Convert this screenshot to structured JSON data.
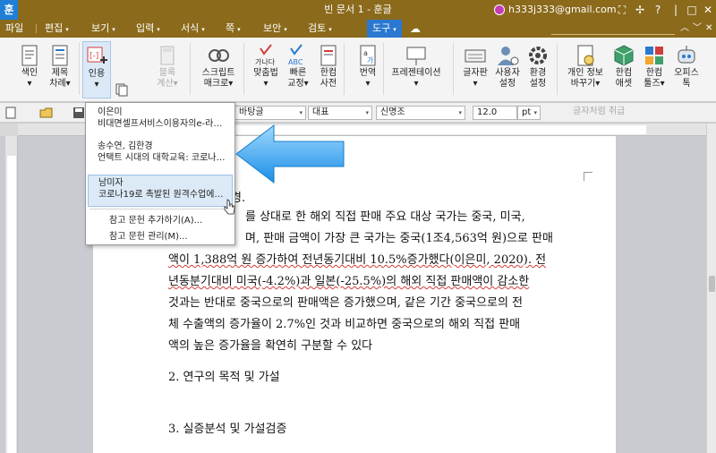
{
  "titlebar": {
    "app_icon": "훈",
    "title": "빈 문서 1 - 훈글",
    "account_email": "h333j333@gmail.com"
  },
  "window_controls": {
    "a": "⛶",
    "b": "✢",
    "help": "?",
    "minimize": "|",
    "maximize": "□",
    "close": "✕"
  },
  "menu": [
    {
      "label": "파일",
      "arrow": ""
    },
    {
      "label": "편집",
      "arrow": "▾"
    },
    {
      "label": "보기",
      "arrow": "▾"
    },
    {
      "label": "입력",
      "arrow": "▾"
    },
    {
      "label": "서식",
      "arrow": "▾"
    },
    {
      "label": "쪽",
      "arrow": "▾"
    },
    {
      "label": "보안",
      "arrow": "▾"
    },
    {
      "label": "검토",
      "arrow": "▾"
    },
    {
      "label": "도구",
      "arrow": "▾"
    }
  ],
  "menu_right": {
    "up": "︿",
    "down": "﹀",
    "close": "✕"
  },
  "ribbon": {
    "index": "색인\n▾",
    "chapter": "제목\n차례▾",
    "cite": "인용\n▾",
    "block_calc": "블록\n계산▾",
    "script": "스크립트\n매크로▾",
    "spell": "맞춤법\n▾",
    "quick": "빠른\n교정▾",
    "dict": "한컴\n사전",
    "translate": "번역\n▾",
    "present": "프레젠테이션\n▾",
    "kbd": "글자판\n▾",
    "user_set": "사용자\n설정",
    "env_set": "환경\n설정",
    "privacy": "개인 정보\n바꾸기▾",
    "asset": "한컴\n애셋",
    "tools": "한컴\n툴즈▾",
    "office_tok": "오피스\n톡",
    "spell_icon_text": "가나다",
    "spell_abc": "ABC"
  },
  "format_bar": {
    "font_lang": "바탕글",
    "font_group": "대표",
    "font_name": "신명조",
    "font_size": "12.0",
    "size_unit": "pt",
    "char_style": "글자처럼 취급"
  },
  "dropdown": {
    "items": [
      {
        "line1": "이은미",
        "line2": "비대면셀프서비스이용자의e-라…"
      },
      {
        "line1": "송수연, 김한경",
        "line2": "언택트 시대의 대학교육: 코로나…"
      },
      {
        "line1": "남미자",
        "line2": "코로나19로 촉발된 원격수업에…"
      }
    ],
    "add_ref": "참고 문헌 추가하기(A)...",
    "manage_ref": "참고 문헌 관리(M)..."
  },
  "document": {
    "line0_tail": "경.",
    "lines": [
      "를 상대로 한 해외 직접 판매 주요 대상 국가는 중국, 미국,",
      "며, 판매 금액이 가장 큰 국가는 중국(1조4,563억 원)으로 판매",
      "액이 1,388억 원 증가하여 전년동기대비 10.5%증가했다(이은미, 2020). 전",
      "년동분기대비 미국(-4.2%)과 일본(-25.5%)의 해외 직접 판매액이 감소한",
      "것과는 반대로 중국으로의 판매액은 증가했으며, 같은 기간 중국으로의 전",
      "체 수출액의 증가율이 2.7%인 것과 비교하면 중국으로의 해외 직접 판매",
      "액의 높은 증가율을 확연히 구분할 수 있다"
    ],
    "heading2": "2. 연구의 목적 및 가설",
    "heading3": "3. 실증분석 및 가설검증"
  }
}
